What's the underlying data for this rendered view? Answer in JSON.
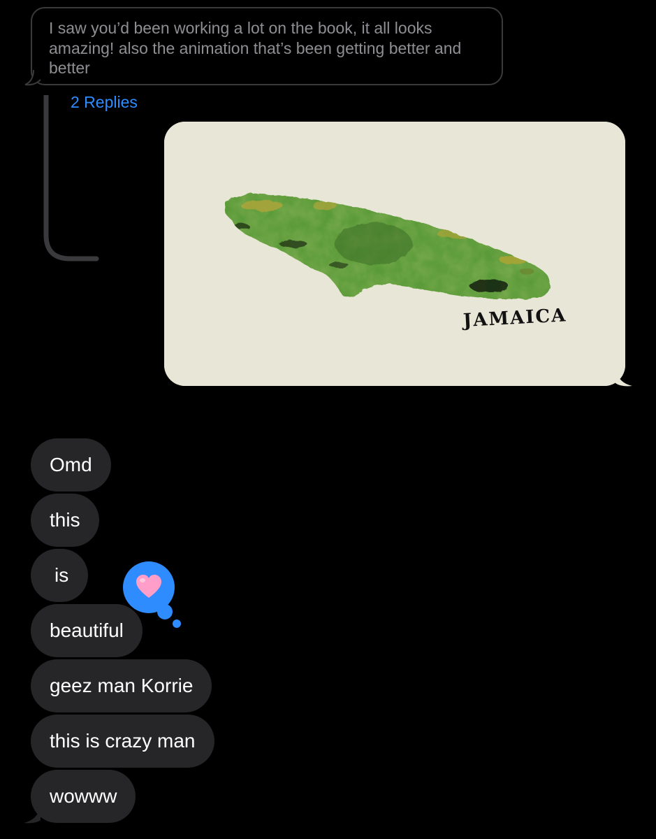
{
  "quoted_message": {
    "text": "I saw you’d been working a lot on the book, it all looks amazing! also the animation that’s been getting better and better"
  },
  "thread": {
    "replies_label": "2 Replies"
  },
  "image_message": {
    "map_label": "JAMAICA"
  },
  "messages": [
    {
      "text": "Omd"
    },
    {
      "text": "this"
    },
    {
      "text": "is"
    },
    {
      "text": "beautiful"
    },
    {
      "text": "geez man Korrie"
    },
    {
      "text": "this is crazy man"
    },
    {
      "text": "wowww"
    }
  ],
  "reaction": {
    "icon": "heart-icon",
    "color": "#2f8cff",
    "heart_color": "#ff9ec8"
  },
  "colors": {
    "background": "#000000",
    "incoming_bubble": "#262629",
    "link": "#2f8cff",
    "quoted_text": "#8e8e93"
  }
}
